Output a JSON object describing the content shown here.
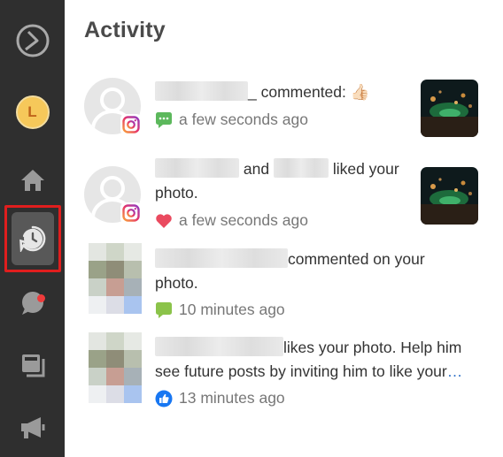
{
  "page": {
    "title": "Activity"
  },
  "sidebar": {
    "avatar_letter": "L",
    "items": [
      {
        "name": "logo",
        "icon": "logo-icon"
      },
      {
        "name": "avatar",
        "icon": "avatar"
      },
      {
        "name": "home",
        "icon": "home-icon"
      },
      {
        "name": "activity",
        "icon": "activity-icon",
        "active": true
      },
      {
        "name": "messages",
        "icon": "message-icon",
        "badge": true
      },
      {
        "name": "posts",
        "icon": "posts-icon"
      },
      {
        "name": "ads",
        "icon": "megaphone-icon"
      }
    ]
  },
  "activity": [
    {
      "text_suffix": "_ commented:",
      "emoji": "👍🏻",
      "time": "a few seconds ago",
      "time_icon": "comment-icon",
      "source_icon": "instagram-icon",
      "has_thumbnail": true
    },
    {
      "text_mid": "and",
      "text_suffix": "liked your",
      "text_line2": "photo.",
      "time": "a few seconds ago",
      "time_icon": "heart-icon",
      "source_icon": "instagram-icon",
      "has_thumbnail": true
    },
    {
      "text_suffix": "commented on your",
      "text_line2": "photo.",
      "time": "10 minutes ago",
      "time_icon": "comment-icon"
    },
    {
      "text_suffix": "likes your photo. Help him",
      "text_line2": "see future posts by inviting him to like your",
      "ellipsis": "…",
      "time": "13 minutes ago",
      "time_icon": "like-icon"
    }
  ],
  "colors": {
    "sidebar_bg": "#2f2f2f",
    "active_highlight": "#e01e1e",
    "comment_green": "#5cb85c",
    "heart_red": "#ea4a5f",
    "like_blue": "#1877f2",
    "link_blue": "#2d6fc7"
  }
}
